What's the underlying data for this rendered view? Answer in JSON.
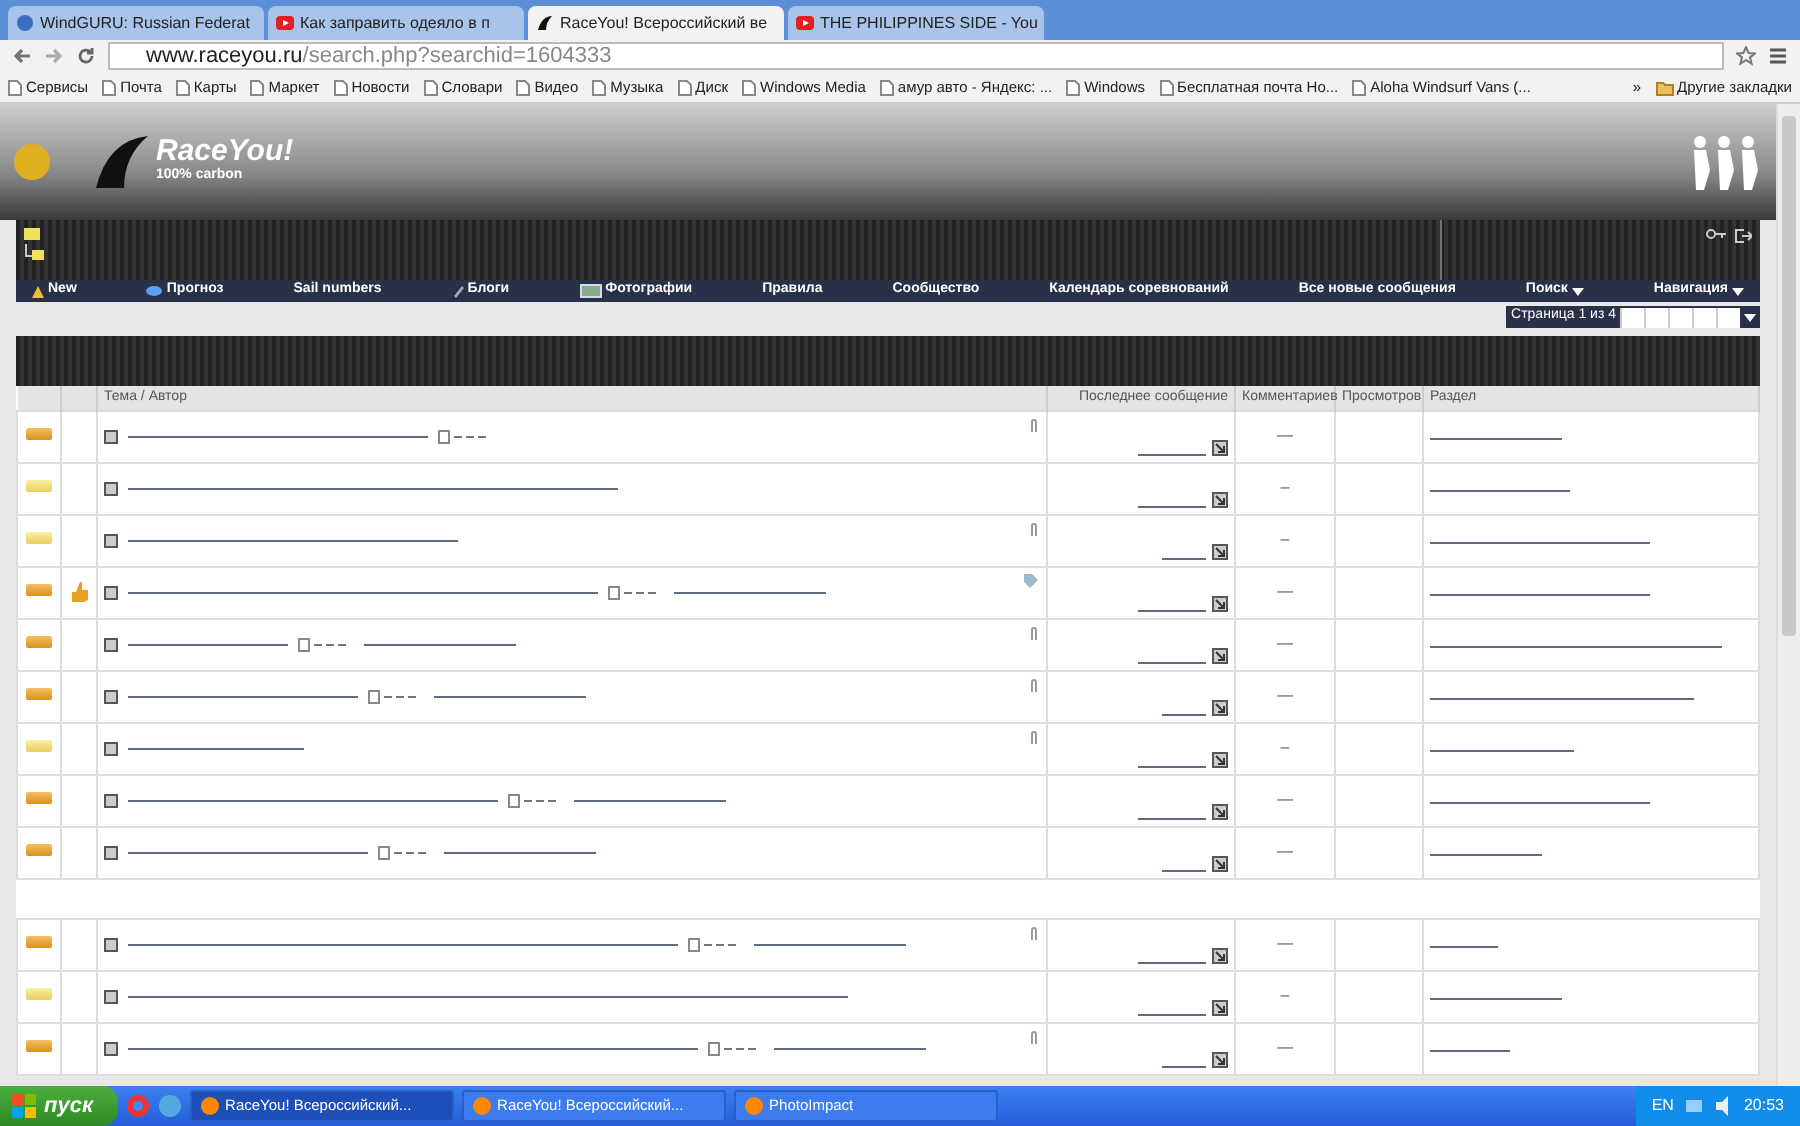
{
  "browser": {
    "tabs": [
      {
        "title": "WindGURU: Russian Federat",
        "selected": false,
        "kind": "site"
      },
      {
        "title": "Как заправить одеяло в п",
        "selected": false,
        "kind": "video"
      },
      {
        "title": "RaceYou! Всероссийский ве",
        "selected": true,
        "kind": "sail"
      },
      {
        "title": "THE PHILIPPINES SIDE - You",
        "selected": false,
        "kind": "video"
      }
    ],
    "address": {
      "host": "www.raceyou.ru",
      "path": "/search.php?searchid=1604333"
    },
    "bookmarks": [
      "Сервисы",
      "Почта",
      "Карты",
      "Маркет",
      "Новости",
      "Словари",
      "Видео",
      "Музыка",
      "Диск",
      "Windows Media",
      "амур авто - Яндекс: ...",
      "Windows",
      "Бесплатная почта Но...",
      "Aloha Windsurf Vans (..."
    ],
    "overflow": "»",
    "other_bookmarks": "Другие закладки"
  },
  "site": {
    "logo": "RaceYou!",
    "tagline": "100% carbon",
    "nav": [
      {
        "label": "New",
        "menu": false
      },
      {
        "label": "Прогноз",
        "menu": false
      },
      {
        "label": "Sail numbers",
        "menu": false
      },
      {
        "label": "Блоги",
        "menu": false
      },
      {
        "label": "Фотографии",
        "menu": false
      },
      {
        "label": "Правила",
        "menu": false
      },
      {
        "label": "Сообщество",
        "menu": false
      },
      {
        "label": "Календарь соревнований",
        "menu": false
      },
      {
        "label": "Все новые сообщения",
        "menu": false
      },
      {
        "label": "Поиск",
        "menu": true
      },
      {
        "label": "Навигация",
        "menu": true
      }
    ],
    "pagination": "Страница 1 из 4"
  },
  "table": {
    "columns": [
      "Тема / Автор",
      "Последнее сообщение",
      "Комментариев",
      "Просмотров",
      "Раздел"
    ],
    "groups": [
      [
        {
          "unread": true,
          "liked": false,
          "pages": true,
          "second_link": false,
          "clip": true,
          "tag": false,
          "comments": "—"
        },
        {
          "unread": false,
          "liked": false,
          "pages": false,
          "second_link": false,
          "clip": false,
          "tag": false,
          "comments": "–"
        },
        {
          "unread": false,
          "liked": false,
          "pages": false,
          "second_link": false,
          "clip": true,
          "tag": false,
          "comments": "–"
        },
        {
          "unread": true,
          "liked": true,
          "pages": true,
          "second_link": true,
          "clip": false,
          "tag": true,
          "comments": "—"
        },
        {
          "unread": true,
          "liked": false,
          "pages": true,
          "second_link": true,
          "clip": true,
          "tag": false,
          "comments": "—"
        },
        {
          "unread": true,
          "liked": false,
          "pages": true,
          "second_link": true,
          "clip": true,
          "tag": false,
          "comments": "—"
        },
        {
          "unread": false,
          "liked": false,
          "pages": false,
          "second_link": false,
          "clip": true,
          "tag": false,
          "comments": "–"
        },
        {
          "unread": true,
          "liked": false,
          "pages": true,
          "second_link": true,
          "clip": false,
          "tag": false,
          "comments": "—"
        },
        {
          "unread": true,
          "liked": false,
          "pages": true,
          "second_link": true,
          "clip": false,
          "tag": false,
          "comments": "—"
        }
      ],
      [
        {
          "unread": true,
          "liked": false,
          "pages": true,
          "second_link": true,
          "clip": true,
          "tag": false,
          "comments": "—"
        },
        {
          "unread": false,
          "liked": false,
          "pages": false,
          "second_link": false,
          "clip": false,
          "tag": false,
          "comments": "–"
        },
        {
          "unread": true,
          "liked": false,
          "pages": true,
          "second_link": true,
          "clip": true,
          "tag": false,
          "comments": "—"
        }
      ]
    ]
  },
  "taskbar": {
    "start": "пуск",
    "windows": [
      {
        "title": "RaceYou! Всероссийский...",
        "selected": true
      },
      {
        "title": "RaceYou! Всероссийский...",
        "selected": false
      },
      {
        "title": "PhotoImpact",
        "selected": false
      }
    ],
    "language": "EN",
    "clock": "20:53"
  }
}
